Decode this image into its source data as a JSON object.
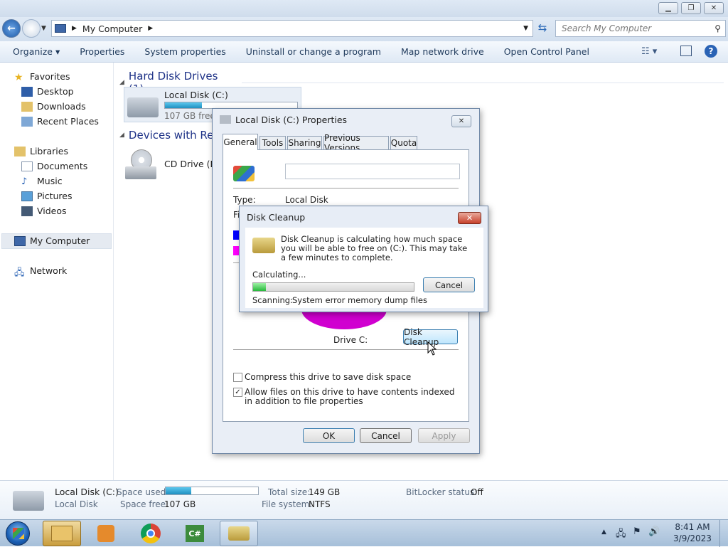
{
  "window": {
    "title_buttons": [
      "minimize-icon",
      "maximize-icon",
      "close-icon"
    ]
  },
  "address": {
    "path": "My Computer",
    "search_placeholder": "Search My Computer"
  },
  "toolbar": {
    "organize": "Organize ▾",
    "properties": "Properties",
    "system_properties": "System properties",
    "uninstall": "Uninstall or change a program",
    "map_network": "Map network drive",
    "open_control_panel": "Open Control Panel"
  },
  "nav": {
    "favorites": "Favorites",
    "desktop": "Desktop",
    "downloads": "Downloads",
    "recent_places": "Recent Places",
    "libraries": "Libraries",
    "documents": "Documents",
    "music": "Music",
    "pictures": "Pictures",
    "videos": "Videos",
    "my_computer": "My Computer",
    "network": "Network"
  },
  "content": {
    "hdd_group": "Hard Disk Drives (1)",
    "local_disk_name": "Local Disk (C:)",
    "local_disk_free": "107 GB free o",
    "local_disk_used_fraction": 0.28,
    "devices_group": "Devices with Rem",
    "cd_drive_name": "CD Drive (D:)"
  },
  "properties_dialog": {
    "title": "Local Disk (C:) Properties",
    "tabs": [
      "General",
      "Tools",
      "Sharing",
      "Previous Versions",
      "Quota"
    ],
    "type_label": "Type:",
    "type_value": "Local Disk",
    "file_system_label_fragment": "Fil",
    "drive_label": "Drive C:",
    "disk_cleanup_button": "Disk Cleanup",
    "compress_label": "Compress this drive to save disk space",
    "compress_checked": false,
    "index_label": "Allow files on this drive to have contents indexed in addition to file properties",
    "index_checked": true,
    "ok": "OK",
    "cancel": "Cancel",
    "apply": "Apply"
  },
  "cleanup_dialog": {
    "title": "Disk Cleanup",
    "message": "Disk Cleanup is calculating how much space you will be able to free on  (C:). This may take a few minutes to complete.",
    "calculating": "Calculating...",
    "progress_fraction": 0.08,
    "cancel": "Cancel",
    "scanning_label": "Scanning:",
    "scanning_item": "System error memory dump files"
  },
  "details": {
    "name": "Local Disk (C:)",
    "type": "Local Disk",
    "space_used_label": "Space used:",
    "space_used_fraction": 0.28,
    "space_free_label": "Space free:",
    "space_free_value": "107 GB",
    "total_size_label": "Total size:",
    "total_size_value": "149 GB",
    "file_system_label": "File system:",
    "file_system_value": "NTFS",
    "bitlocker_label": "BitLocker status:",
    "bitlocker_value": "Off"
  },
  "taskbar": {
    "time": "8:41 AM",
    "date": "3/9/2023",
    "apps": [
      "start-orb-icon",
      "explorer-icon",
      "media-player-icon",
      "chrome-icon",
      "csharp-icon",
      "disk-cleanup-icon"
    ]
  },
  "colors": {
    "progress_green": "#3cc35a",
    "drive_bar": "#2aa7d6",
    "used_blue": "#0000ff",
    "free_magenta": "#ff00ff"
  }
}
